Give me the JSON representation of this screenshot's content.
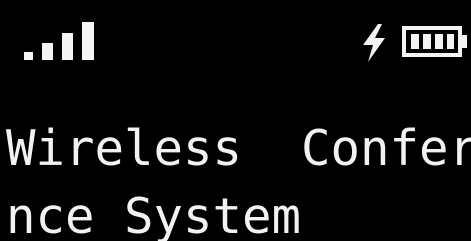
{
  "status_bar": {
    "signal_icon": "signal-strength-icon",
    "signal_level": 4,
    "signal_max": 4,
    "charging_icon": "lightning-bolt-icon",
    "battery_icon": "battery-icon",
    "battery_level": 1.0
  },
  "display": {
    "line_1": "Wireless  Confere",
    "line_2": "nce System"
  },
  "colors": {
    "background": "#000000",
    "foreground": "#f2f2f2"
  }
}
